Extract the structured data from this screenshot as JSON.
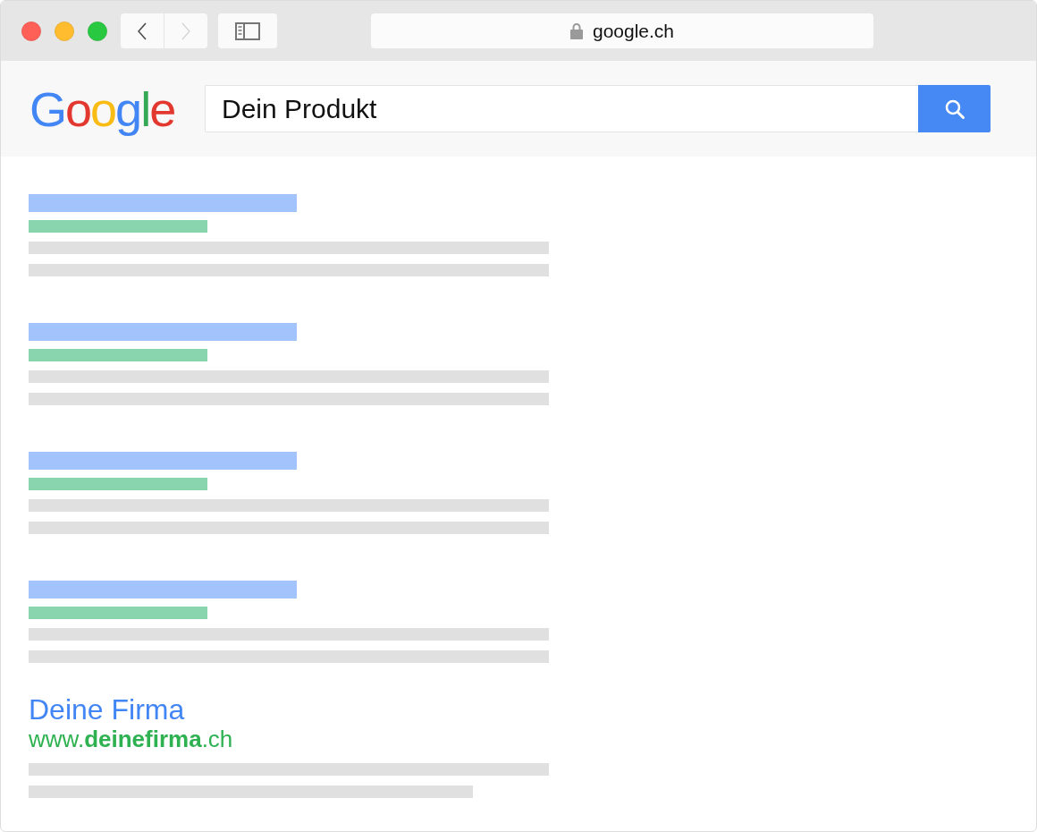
{
  "toolbar": {
    "nav_buttons": [
      {
        "kind": "back",
        "disabled": false
      },
      {
        "kind": "forward",
        "disabled": true
      }
    ],
    "address": "google.ch"
  },
  "search": {
    "logo": "Google",
    "value": "Dein Produkt"
  },
  "results": [
    {
      "kind": "placeholder"
    },
    {
      "kind": "placeholder"
    },
    {
      "kind": "placeholder"
    },
    {
      "kind": "placeholder"
    },
    {
      "kind": "listing",
      "title": "Deine Firma",
      "url": "www.**deinefirma**.ch"
    }
  ]
}
